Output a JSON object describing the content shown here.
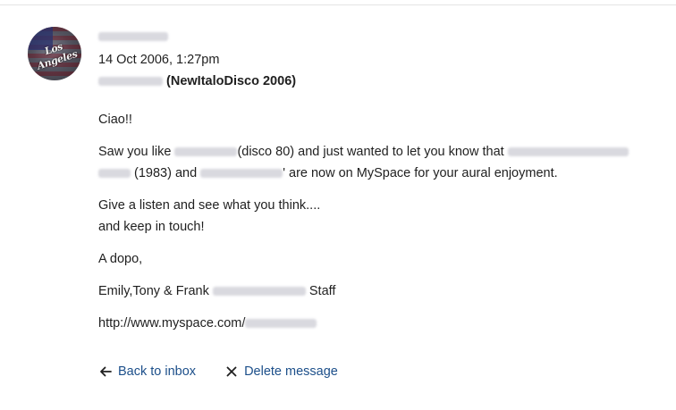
{
  "message": {
    "date": "14 Oct 2006, 1:27pm",
    "subject_suffix": "(NewItaloDisco 2006)",
    "greeting": "Ciao!!",
    "para1_a": "Saw you like ",
    "para1_b": "(disco 80) and just wanted to let you know that ",
    "para1_c": " (1983) and ",
    "para1_d": "' are now on MySpace for your aural enjoyment.",
    "para2_line1": "Give a listen and see what you think....",
    "para2_line2": "and keep in touch!",
    "closing": "A dopo,",
    "signature_a": "Emily,Tony & Frank ",
    "signature_b": " Staff",
    "link_prefix": "http://www.myspace.com/"
  },
  "actions": {
    "back_label": "Back to inbox",
    "delete_label": "Delete message"
  },
  "avatar": {
    "logo_text": "Los Angeles"
  },
  "colors": {
    "link": "#1c4f8a",
    "text": "#1f1f1f"
  }
}
